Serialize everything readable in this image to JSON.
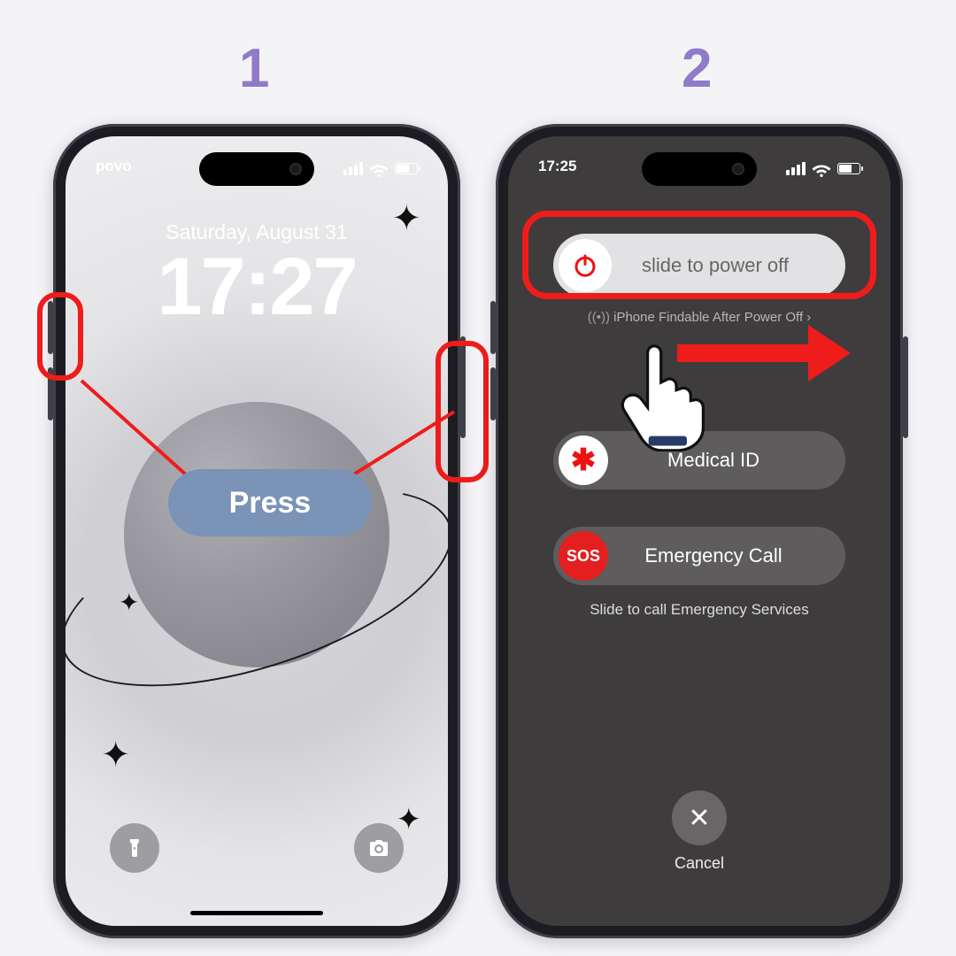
{
  "steps": {
    "one": "1",
    "two": "2"
  },
  "left": {
    "carrier": "povo",
    "date": "Saturday, August 31",
    "time": "17:27",
    "press_label": "Press",
    "flashlight": "flashlight",
    "camera": "camera"
  },
  "right": {
    "status_time": "17:25",
    "power_slider": "slide to power off",
    "findable": "iPhone Findable After Power Off",
    "medical": "Medical ID",
    "sos": "SOS",
    "emergency": "Emergency Call",
    "emergency_hint": "Slide to call Emergency Services",
    "cancel": "Cancel"
  },
  "colors": {
    "accent_red": "#ef1c1c",
    "step_purple": "#8f7bc9"
  }
}
